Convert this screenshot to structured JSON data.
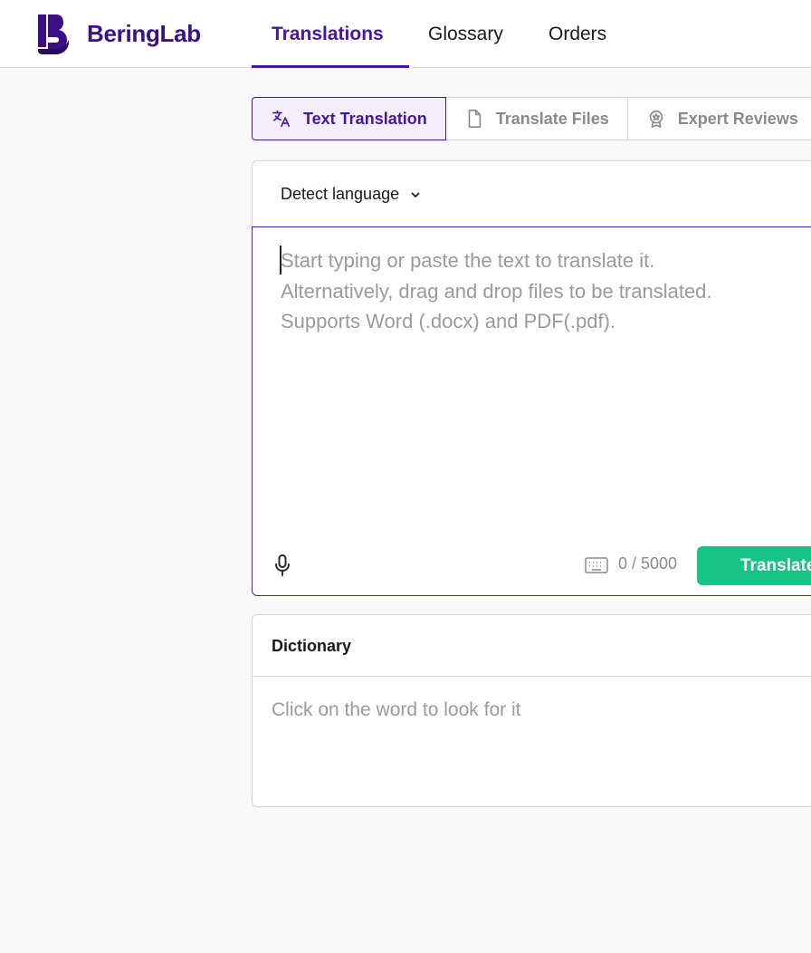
{
  "brand": {
    "name": "BeringLab",
    "color": "#3b1086"
  },
  "nav": {
    "tabs": [
      {
        "label": "Translations",
        "active": true
      },
      {
        "label": "Glossary",
        "active": false
      },
      {
        "label": "Orders",
        "active": false
      }
    ]
  },
  "modes": [
    {
      "label": "Text Translation",
      "icon": "translate-icon",
      "active": true
    },
    {
      "label": "Translate Files",
      "icon": "file-icon",
      "active": false
    },
    {
      "label": "Expert Reviews",
      "icon": "award-badge-icon",
      "active": false
    }
  ],
  "translator": {
    "source_language": "Detect language",
    "placeholder_lines": [
      "Start typing or paste the text to translate it.",
      "Alternatively, drag and drop files to be translated.",
      "Supports Word (.docx) and PDF(.pdf)."
    ],
    "char_count": "0 / 5000",
    "translate_label": "Translate"
  },
  "dictionary": {
    "title": "Dictionary",
    "hint": "Click on the word to look for it"
  },
  "colors": {
    "accent": "#4a13a3",
    "accent_bg": "#f2eefa",
    "button_green": "#17c285",
    "placeholder_gray": "#9a9a9a"
  }
}
